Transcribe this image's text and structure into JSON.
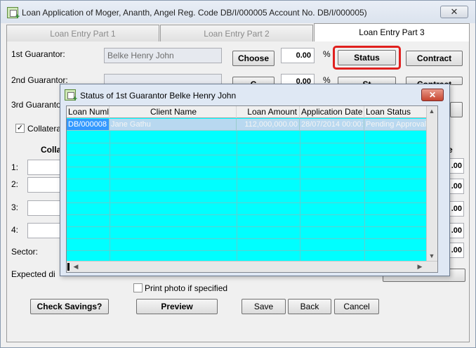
{
  "window": {
    "title": "Loan Application of Moger, Ananth, Angel Reg. Code DB/I/000005 Account No. DB/I/000005)",
    "close_glyph": "✕"
  },
  "tabs": [
    {
      "label": "Loan Entry Part 1"
    },
    {
      "label": "Loan Entry Part 2"
    },
    {
      "label": "Loan Entry Part 3"
    }
  ],
  "guarantors": {
    "g1_label": "1st Guarantor:",
    "g1_value": "Belke Henry John",
    "g2_label": "2nd Guarantor:",
    "g3_label": "3rd Guaranto",
    "choose": "Choose",
    "choose_hidden": "C",
    "pct": "0.00",
    "pct_sign": "%",
    "status": "Status",
    "status_hidden": "St",
    "contract": "Contract"
  },
  "collateral": {
    "checkbox_label": "Collatera",
    "heading": "Colla",
    "right_heading": "e",
    "rows": [
      "1:",
      "2:",
      "3:",
      "4:"
    ],
    "right_values": [
      ".00",
      ".00",
      ".00",
      ".00",
      ".00"
    ],
    "checked_mark": "✓"
  },
  "sector_label": "Sector:",
  "expected_label": "Expected di",
  "print_photo": "Print photo if specified",
  "buttons": {
    "check_savings": "Check Savings?",
    "preview": "Preview",
    "save": "Save",
    "back": "Back",
    "cancel": "Cancel"
  },
  "dialog": {
    "title": "Status of 1st Guarantor Belke Henry John",
    "close_glyph": "✕",
    "columns": [
      "Loan Numl",
      "Client Name",
      "Loan Amount",
      "Application Date",
      "Loan Status"
    ],
    "rows": [
      {
        "loan_number": "DB/000008",
        "client_name": "Jane Gathu",
        "loan_amount": "112,000,000.00",
        "application_date": "28/07/2014 00:00:",
        "loan_status": "Pending Approval"
      }
    ]
  },
  "colors": {
    "grid_bg": "#00ffff",
    "selected_row": "#b8d8f0",
    "highlight_ring": "#e0201e"
  }
}
